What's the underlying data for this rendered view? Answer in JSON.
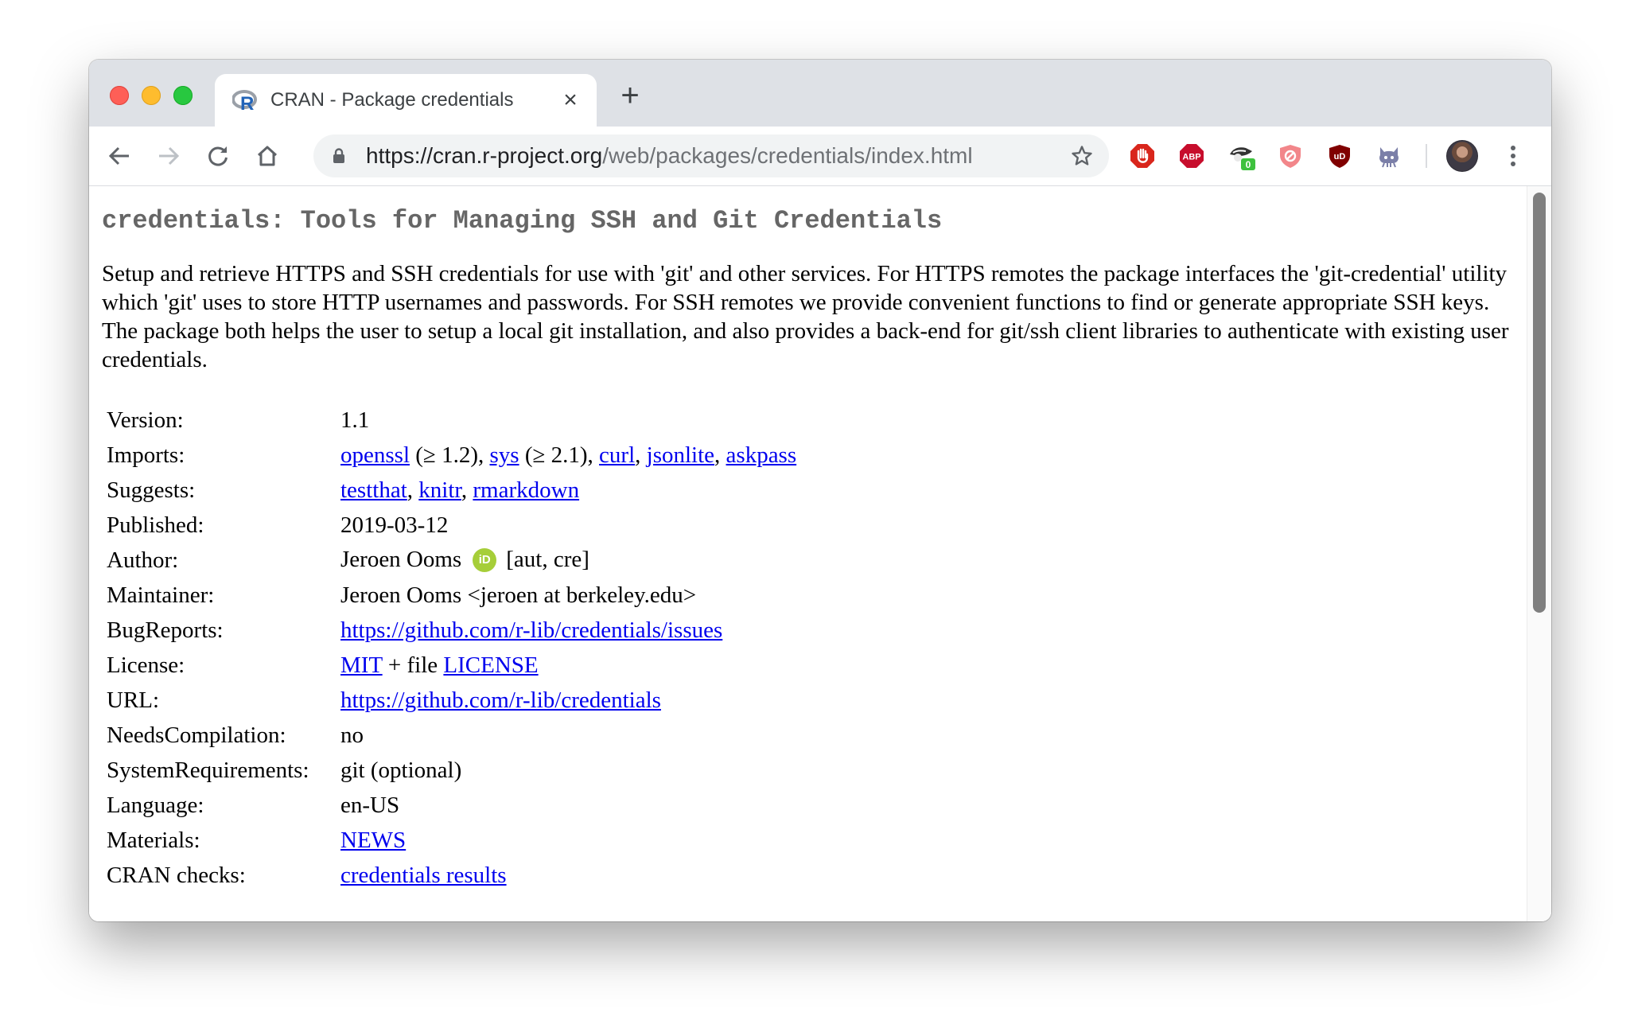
{
  "browser": {
    "tab_title": "CRAN - Package credentials",
    "tab_close_glyph": "×",
    "new_tab_glyph": "+",
    "url_host": "https://cran.r-project.org",
    "url_path": "/web/packages/credentials/index.html",
    "extensions": [
      "adblock-stop-icon",
      "abp-icon",
      "privacy-badger-icon",
      "shield-icon",
      "ublock-icon",
      "octocat-icon"
    ],
    "privacy_badger_count": "0",
    "abp_label": "ABP",
    "ublock_label": "uD"
  },
  "colors": {
    "link": "#0000ee",
    "title_gray": "#666666",
    "orcid_green": "#a6ce39"
  },
  "page": {
    "title": "credentials: Tools for Managing SSH and Git Credentials",
    "description": "Setup and retrieve HTTPS and SSH credentials for use with 'git' and other services. For HTTPS remotes the package interfaces the 'git-credential' utility which 'git' uses to store HTTP usernames and passwords. For SSH remotes we provide convenient functions to find or generate appropriate SSH keys. The package both helps the user to setup a local git installation, and also provides a back-end for git/ssh client libraries to authenticate with existing user credentials.",
    "meta": {
      "version": {
        "label": "Version:",
        "value": "1.1"
      },
      "imports": {
        "label": "Imports:",
        "openssl": "openssl",
        "openssl_ver": " (≥ 1.2), ",
        "sys": "sys",
        "sys_ver": " (≥ 2.1), ",
        "curl": "curl",
        "sep1": ", ",
        "jsonlite": "jsonlite",
        "sep2": ", ",
        "askpass": "askpass"
      },
      "suggests": {
        "label": "Suggests:",
        "testthat": "testthat",
        "sep1": ", ",
        "knitr": "knitr",
        "sep2": ", ",
        "rmarkdown": "rmarkdown"
      },
      "published": {
        "label": "Published:",
        "value": "2019-03-12"
      },
      "author": {
        "label": "Author:",
        "name": "Jeroen Ooms",
        "orcid": "iD",
        "roles": "[aut, cre]"
      },
      "maintainer": {
        "label": "Maintainer:",
        "value": "Jeroen Ooms <jeroen at berkeley.edu>"
      },
      "bugreports": {
        "label": "BugReports:",
        "value": "https://github.com/r-lib/credentials/issues"
      },
      "license": {
        "label": "License:",
        "mit": "MIT",
        "middle": " + file ",
        "file": "LICENSE"
      },
      "url": {
        "label": "URL:",
        "value": "https://github.com/r-lib/credentials"
      },
      "needs_compilation": {
        "label": "NeedsCompilation:",
        "value": "no"
      },
      "system_requirements": {
        "label": "SystemRequirements:",
        "value": "git (optional)"
      },
      "language": {
        "label": "Language:",
        "value": "en-US"
      },
      "materials": {
        "label": "Materials:",
        "value": "NEWS"
      },
      "cran_checks": {
        "label": "CRAN checks:",
        "value": "credentials results"
      }
    }
  }
}
